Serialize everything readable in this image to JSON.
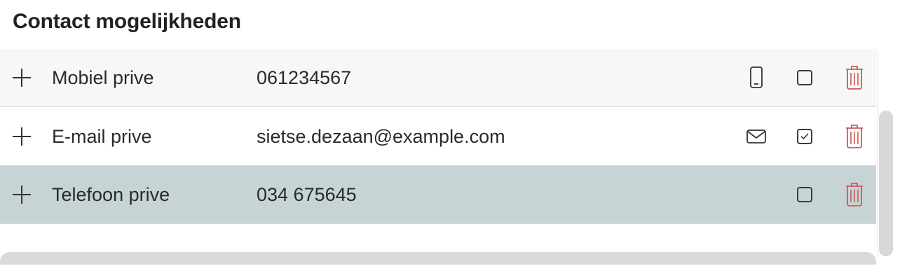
{
  "section": {
    "title": "Contact mogelijkheden"
  },
  "contacts": [
    {
      "label": "Mobiel prive",
      "value": "061234567",
      "type_icon": "mobile-phone-icon",
      "checked": false,
      "selected": false
    },
    {
      "label": "E-mail prive",
      "value": "sietse.dezaan@example.com",
      "type_icon": "envelope-icon",
      "checked": true,
      "selected": false
    },
    {
      "label": "Telefoon prive",
      "value": "034 675645",
      "type_icon": "",
      "checked": false,
      "selected": true
    }
  ],
  "colors": {
    "selected_row": "#c7d4d6",
    "delete_icon": "#cc5a5a",
    "text": "#2a2a2a"
  }
}
